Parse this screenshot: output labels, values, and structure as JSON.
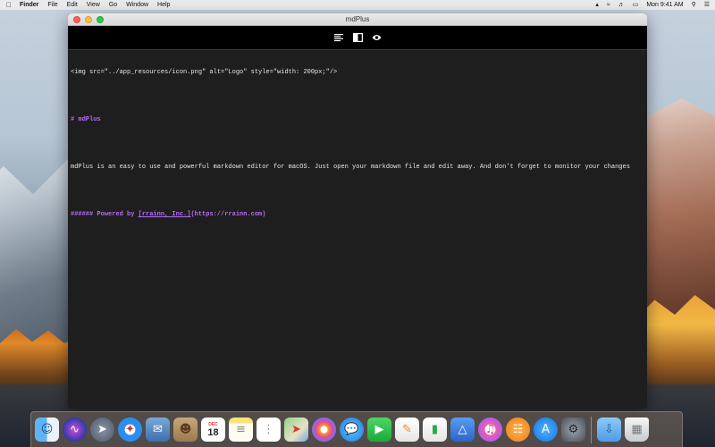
{
  "menubar": {
    "items": [
      "Finder",
      "File",
      "Edit",
      "View",
      "Go",
      "Window",
      "Help"
    ],
    "clock": "Mon 9:41 AM"
  },
  "window": {
    "title": "mdPlus"
  },
  "toolbar": {
    "buttons": [
      "editor-only-icon",
      "split-view-icon",
      "preview-eye-icon"
    ]
  },
  "editor": {
    "lines": [
      "<img src=\"../app_resources/icon.png\" alt=\"Logo\" style=\"width: 200px;\"/>",
      "# mdPlus",
      "mdPlus is an easy to use and powerful markdown editor for macOS. Just open your markdown file and edit away. And don't forget to monitor your changes",
      "###### Powered by ",
      "[rrainn, Inc.]",
      "(https://rrainn.com)"
    ]
  },
  "dock": {
    "calendar_month": "DEC",
    "calendar_day": "18",
    "icons": [
      "finder-icon",
      "siri-icon",
      "launchpad-icon",
      "safari-icon",
      "mail-icon",
      "contacts-icon",
      "calendar-icon",
      "notes-icon",
      "reminders-icon",
      "maps-icon",
      "photos-icon",
      "messages-icon",
      "facetime-icon",
      "pages-icon",
      "numbers-icon",
      "keynote-icon",
      "itunes-icon",
      "ibooks-icon",
      "app-store-icon",
      "system-preferences-icon",
      "downloads-folder-icon",
      "trash-icon"
    ]
  },
  "colors": {
    "editor_bg": "#1e1e1e",
    "heading": "#b46cf6",
    "text": "#e6e6e6",
    "toolbar_bg": "#000000"
  }
}
